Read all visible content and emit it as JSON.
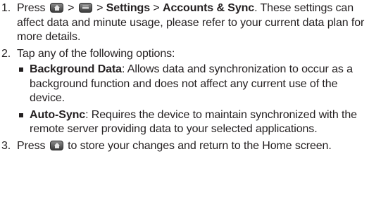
{
  "steps": [
    {
      "number": "1.",
      "prefix": "Press",
      "sep1": ">",
      "sep2": ">",
      "settings": "Settings",
      "sep3": ">",
      "accounts": "Accounts & Sync",
      "rest": ". These settings can affect data and minute usage, please refer to your current data plan for more details.",
      "icons": [
        "home-key-icon",
        "menu-key-icon"
      ]
    },
    {
      "number": "2.",
      "text": "Tap any of the following options:",
      "bullets": [
        {
          "term": "Background Data",
          "description": ": Allows data and synchronization to occur as a background function and does not affect any current use of the device."
        },
        {
          "term": "Auto-Sync",
          "description": ": Requires the device to maintain synchronized with the remote server providing data to your selected applications."
        }
      ]
    },
    {
      "number": "3.",
      "prefix": "Press",
      "rest": "to store your changes and return to the Home screen.",
      "icons": [
        "home-key-icon"
      ]
    }
  ]
}
